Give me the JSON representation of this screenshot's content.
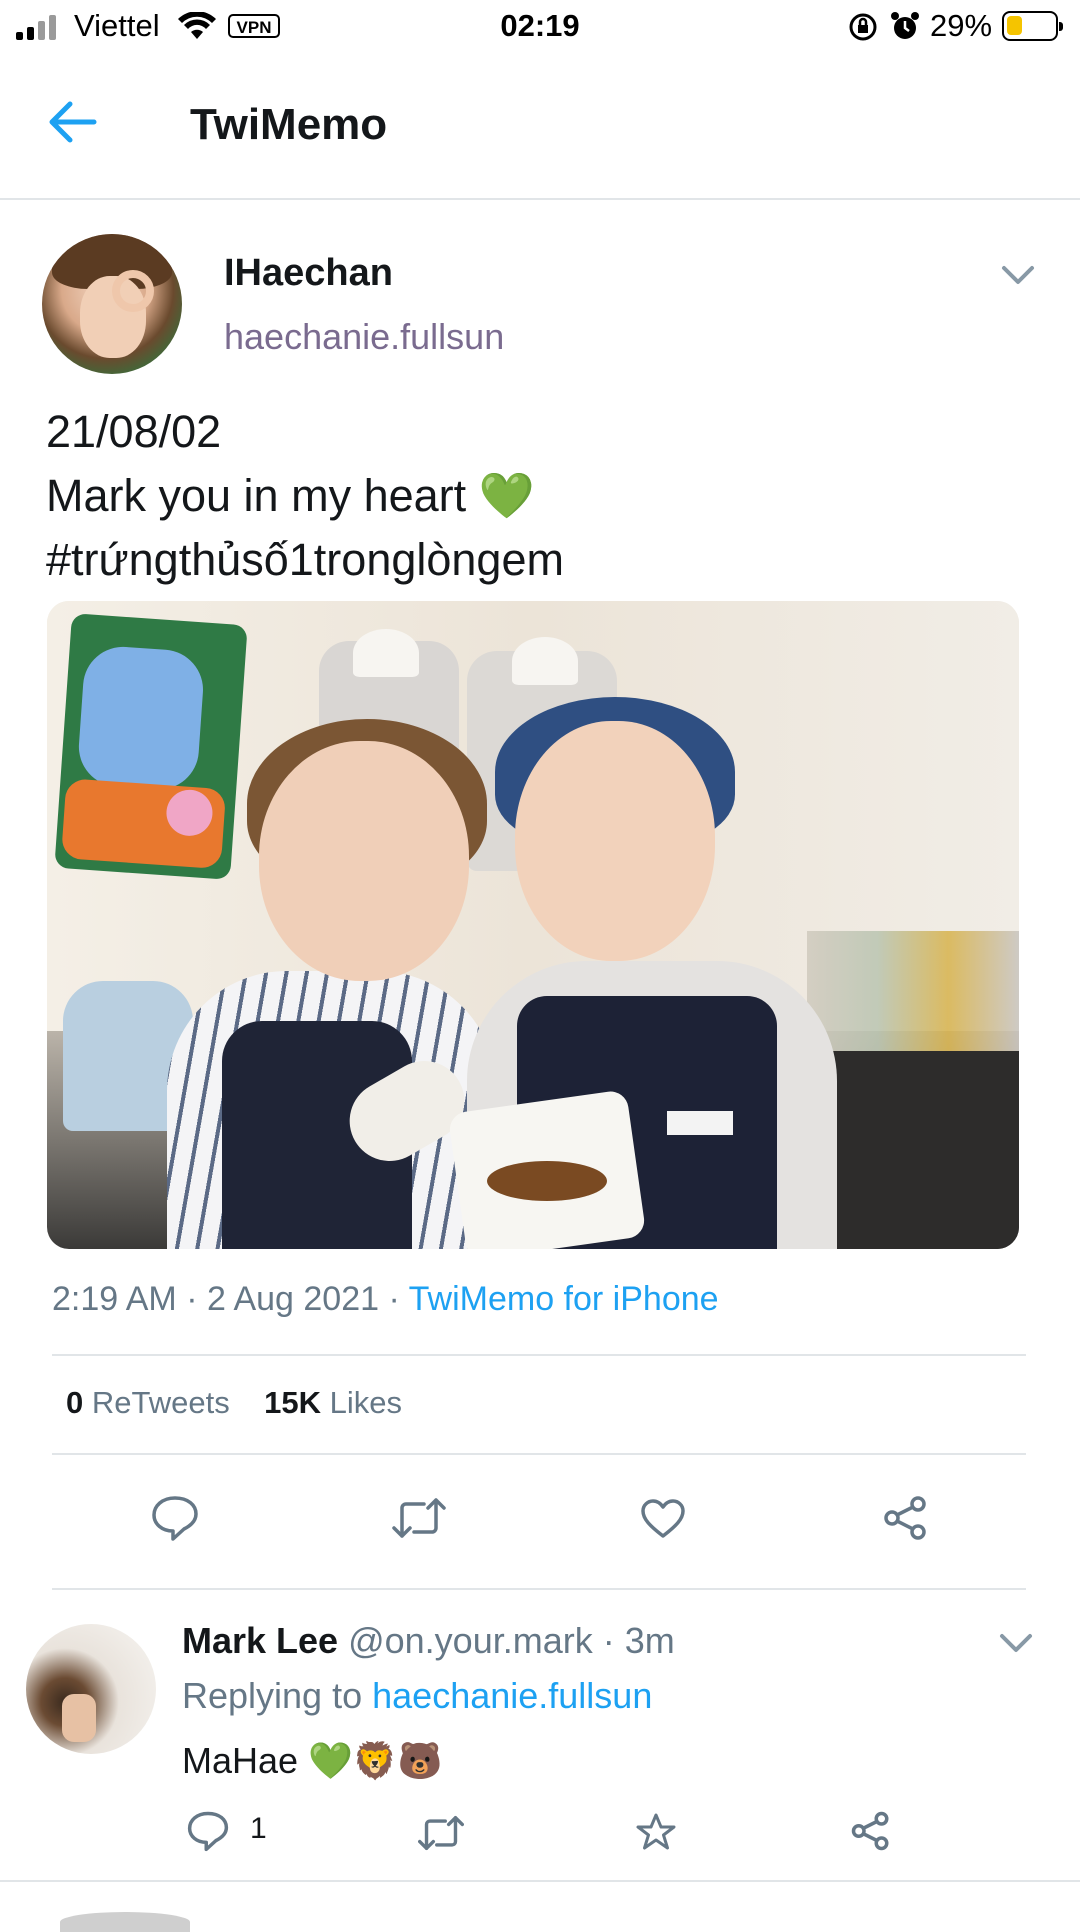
{
  "status_bar": {
    "carrier": "Viettel",
    "vpn": "VPN",
    "time": "02:19",
    "battery_percent": "29%"
  },
  "nav": {
    "title": "TwiMemo",
    "back_icon": "arrow-left-icon"
  },
  "tweet": {
    "display_name": "IHaechan",
    "handle": "haechanie.fullsun",
    "text_line1": "21/08/02",
    "text_line2": "Mark you in my heart 💚",
    "text_line3": "#trứngthủsố1tronglòngem",
    "time": "2:19 AM",
    "date": "2 Aug 2021",
    "source": "TwiMemo for iPhone",
    "retweets_count": "0",
    "retweets_label": "ReTweets",
    "likes_count": "15K",
    "likes_label": "Likes"
  },
  "reply": {
    "display_name": "Mark Lee",
    "handle": "@on.your.mark",
    "age": "3m",
    "replying_prefix": "Replying to",
    "replying_to": "haechanie.fullsun",
    "text": "MaHae 💚🦁🐻",
    "reply_count": "1"
  },
  "colors": {
    "accent": "#1da1f2",
    "text": "#14171a",
    "muted": "#657786",
    "divider": "#e1e5e8"
  }
}
